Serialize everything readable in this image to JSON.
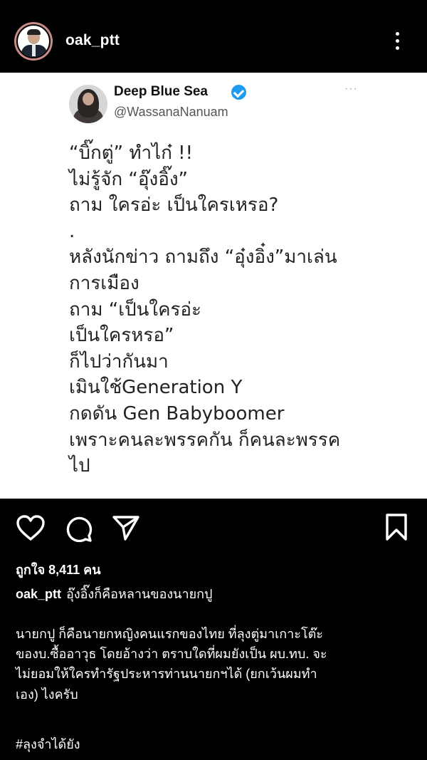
{
  "post": {
    "username": "oak_ptt",
    "likes_text": "ถูกใจ 8,411 คน",
    "caption": "อุ๊งอิ๊งก็คือหลานของนายกปู",
    "body_lines": [
      "นายกปู ก็คือนายกหญิงคนแรกของไทย ที่ลุงตู่มาเกาะโต๊ะ",
      "ของบ.ซื้ออาวุธ โดยอ้างว่า ตราบใดที่ผมยังเป็น ผบ.ทบ. จะ",
      "ไม่ยอมให้ใครทำรัฐประหารท่านนายกฯได้ (ยกเว้นผมทำ",
      "เอง) ไงครับ"
    ],
    "hashtag": "#ลุงจำได้ยัง"
  },
  "tweet": {
    "display_name": "Deep Blue Sea",
    "handle": "@WassanaNanuam",
    "more": "···",
    "lines": [
      "“บิ๊กตู่” ทำไก๋ !!",
      "ไม่รู้จัก “อุ๊งอิ๊ง”",
      "ถาม ใครอ่ะ เป็นใครเหรอ?",
      ".",
      "หลังนักข่าว ถามถึง “อุ๋งอิ๋ง”มาเล่น",
      "การเมือง",
      "ถาม “เป็นใครอ่ะ",
      "เป็นใครหรอ”",
      "ก็ไปว่ากันมา",
      "เมินใช้Generation Y",
      "กดดัน Gen Babyboomer",
      "เพราะคนละพรรคกัน  ก็คนละพรรค",
      "ไป"
    ]
  },
  "icons": {
    "more": "more-vertical-icon",
    "like": "heart-icon",
    "comment": "comment-icon",
    "share": "send-icon",
    "save": "bookmark-icon",
    "verified": "verified-badge-icon"
  },
  "colors": {
    "background": "#000000",
    "verified": "#1d9bf0",
    "text": "#ffffff"
  }
}
